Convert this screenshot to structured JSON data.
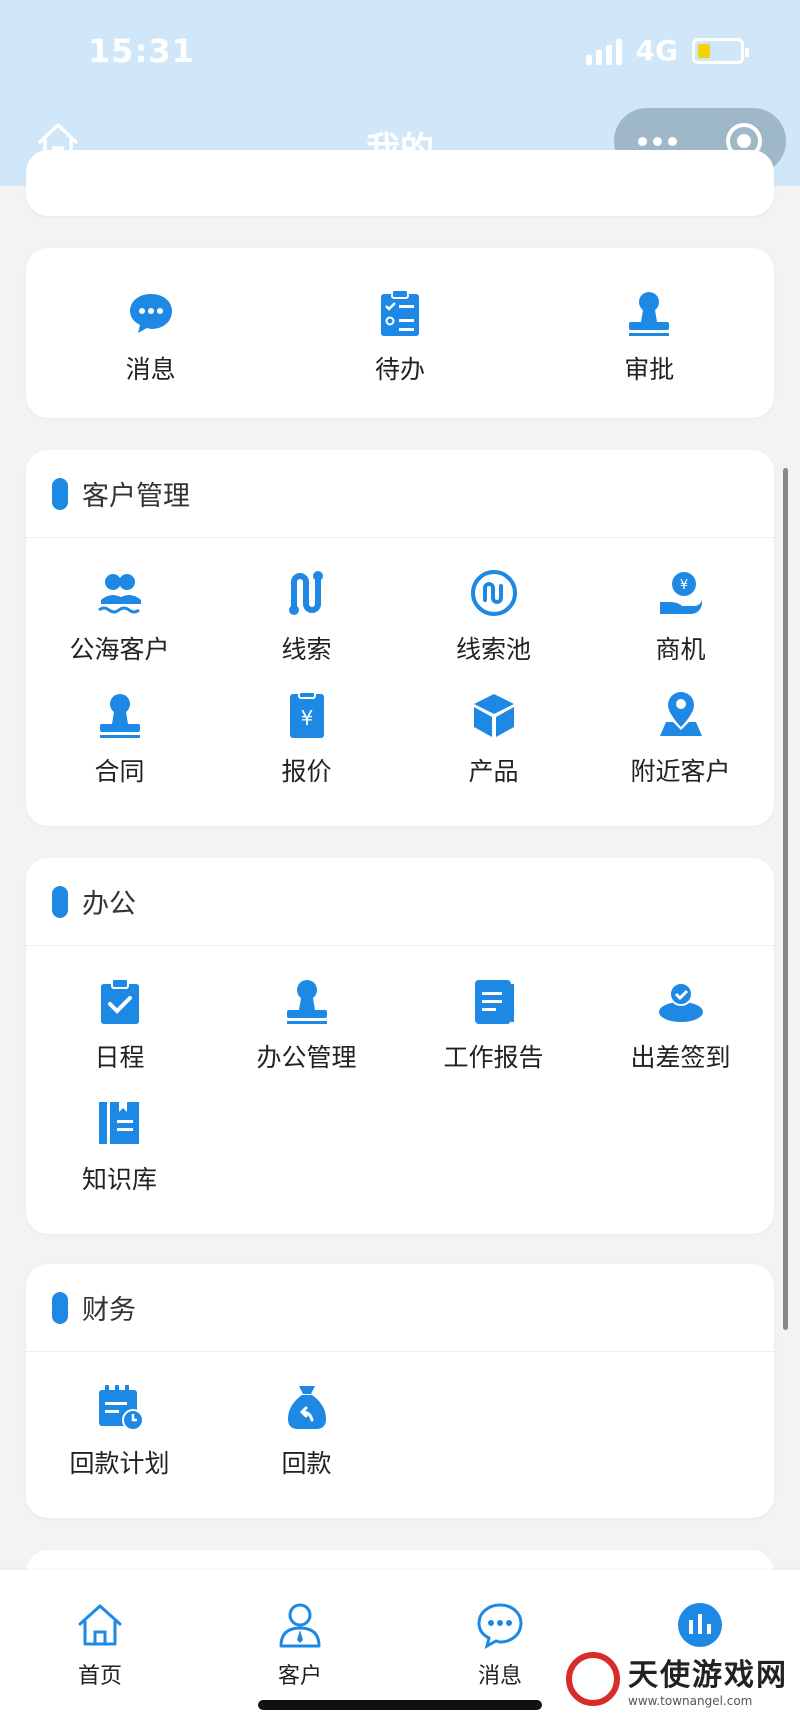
{
  "status_bar": {
    "time": "15:31",
    "network": "4G"
  },
  "header": {
    "title": "我的"
  },
  "quick": {
    "items": [
      {
        "label": "消息",
        "icon": "chat-bubble-icon"
      },
      {
        "label": "待办",
        "icon": "clipboard-list-icon"
      },
      {
        "label": "审批",
        "icon": "stamp-icon"
      }
    ]
  },
  "customer": {
    "title": "客户管理",
    "items": [
      {
        "label": "公海客户",
        "icon": "users-icon"
      },
      {
        "label": "线索",
        "icon": "path-icon"
      },
      {
        "label": "线索池",
        "icon": "circle-path-icon"
      },
      {
        "label": "商机",
        "icon": "hand-coin-icon"
      },
      {
        "label": "合同",
        "icon": "stamp-icon"
      },
      {
        "label": "报价",
        "icon": "yuan-doc-icon"
      },
      {
        "label": "产品",
        "icon": "box-icon"
      },
      {
        "label": "附近客户",
        "icon": "location-user-icon"
      }
    ]
  },
  "office": {
    "title": "办公",
    "items": [
      {
        "label": "日程",
        "icon": "calendar-check-icon"
      },
      {
        "label": "办公管理",
        "icon": "stamp-icon"
      },
      {
        "label": "工作报告",
        "icon": "report-book-icon"
      },
      {
        "label": "出差签到",
        "icon": "check-in-pin-icon"
      },
      {
        "label": "知识库",
        "icon": "books-icon"
      }
    ]
  },
  "finance": {
    "title": "财务",
    "items": [
      {
        "label": "回款计划",
        "icon": "plan-calendar-icon"
      },
      {
        "label": "回款",
        "icon": "money-bag-icon"
      }
    ]
  },
  "tabbar": {
    "items": [
      {
        "label": "首页",
        "icon": "home-icon"
      },
      {
        "label": "客户",
        "icon": "person-icon"
      },
      {
        "label": "消息",
        "icon": "message-icon"
      }
    ]
  },
  "watermark": {
    "text": "天使游戏网",
    "sub": "www.townangel.com"
  },
  "colors": {
    "accent": "#1e88e5",
    "header_bg": "#cfe7f8"
  }
}
